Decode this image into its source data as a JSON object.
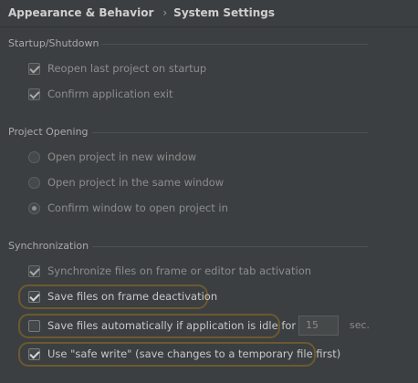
{
  "header": {
    "breadcrumb_parent": "Appearance & Behavior",
    "breadcrumb_separator": "›",
    "breadcrumb_current": "System Settings"
  },
  "startup": {
    "title": "Startup/Shutdown",
    "reopen_label": "Reopen last project on startup",
    "reopen_checked": true,
    "confirm_exit_label": "Confirm application exit",
    "confirm_exit_checked": true
  },
  "project_opening": {
    "title": "Project Opening",
    "options": [
      {
        "label": "Open project in new window",
        "selected": false
      },
      {
        "label": "Open project in the same window",
        "selected": false
      },
      {
        "label": "Confirm window to open project in",
        "selected": true
      }
    ]
  },
  "synchronization": {
    "title": "Synchronization",
    "sync_label": "Synchronize files on frame or editor tab activation",
    "sync_checked": true,
    "save_deactivation_label": "Save files on frame deactivation",
    "save_deactivation_checked": true,
    "save_idle_label": "Save files automatically if application is idle for",
    "save_idle_checked": false,
    "idle_value": "15",
    "idle_unit": "sec.",
    "safe_write_label": "Use \"safe write\" (save changes to a temporary file first)",
    "safe_write_checked": true
  },
  "colors": {
    "background": "#3c3f41",
    "highlight_outline": "#6b5a2e"
  }
}
